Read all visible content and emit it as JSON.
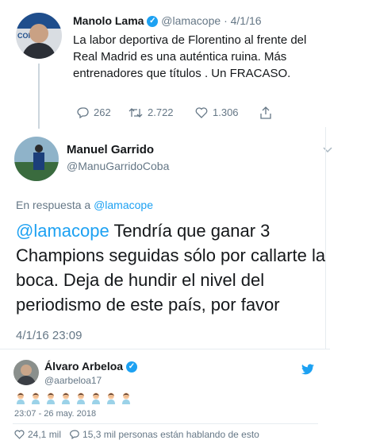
{
  "tweet1": {
    "name": "Manolo Lama",
    "handle": "@lamacope",
    "separator": "·",
    "date": "4/1/16",
    "text": "La labor deportiva de Florentino al frente del Real Madrid es una auténtica ruina. Más entrenadores que títulos . Un FRACASO.",
    "replies": "262",
    "retweets": "2.722",
    "likes": "1.306",
    "avatar_text": "COP"
  },
  "tweet2": {
    "name": "Manuel Garrido",
    "handle": "@ManuGarridoCoba",
    "reply_prefix": "En respuesta a",
    "reply_to": "@lamacope",
    "mention": "@lamacope",
    "text": " Tendría que ganar 3 Champions seguidas sólo por callarte la boca. Deja de hundir el nivel del periodismo de este país, por favor",
    "timestamp": "4/1/16 23:09"
  },
  "tweet3": {
    "name": "Álvaro Arbeloa",
    "handle": "@aarbeloa17",
    "emoji_count": 8,
    "timestamp": "23:07 - 26 may. 2018",
    "likes": "24,1 mil",
    "talking": "15,3 mil personas están hablando de esto"
  },
  "colors": {
    "brand": "#1da1f2",
    "muted": "#657786",
    "text": "#14171a",
    "divider": "#e6ecf0"
  }
}
